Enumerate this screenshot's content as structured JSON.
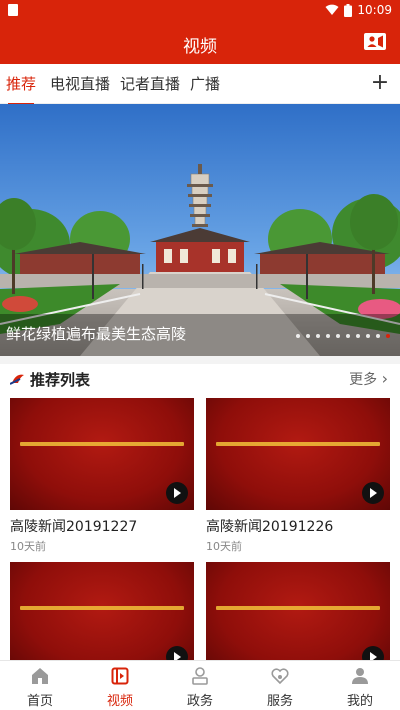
{
  "status_bar": {
    "time": "10:09"
  },
  "header": {
    "title": "视频"
  },
  "tabs": [
    {
      "label": "推荐",
      "active": true
    },
    {
      "label": "电视直播",
      "active": false
    },
    {
      "label": "记者直播",
      "active": false
    },
    {
      "label": "广播",
      "active": false
    }
  ],
  "add_icon": "plus-icon",
  "banner": {
    "caption": "鲜花绿植遍布最美生态高陵",
    "slide_count": 10,
    "active_slide": 10
  },
  "section": {
    "title": "推荐列表",
    "more_label": "更多"
  },
  "videos": [
    {
      "title": "高陵新闻20191227",
      "time": "10天前"
    },
    {
      "title": "高陵新闻20191226",
      "time": "10天前"
    },
    {
      "title": "",
      "time": ""
    },
    {
      "title": "",
      "time": ""
    }
  ],
  "bottom_nav": [
    {
      "label": "首页",
      "icon": "home-icon",
      "active": false
    },
    {
      "label": "视频",
      "icon": "video-icon",
      "active": true
    },
    {
      "label": "政务",
      "icon": "government-icon",
      "active": false
    },
    {
      "label": "服务",
      "icon": "service-icon",
      "active": false
    },
    {
      "label": "我的",
      "icon": "profile-icon",
      "active": false
    }
  ],
  "colors": {
    "brand": "#d8240a",
    "thumb_red": "#8f0e0a",
    "inactive_icon": "#9a9a9a"
  }
}
